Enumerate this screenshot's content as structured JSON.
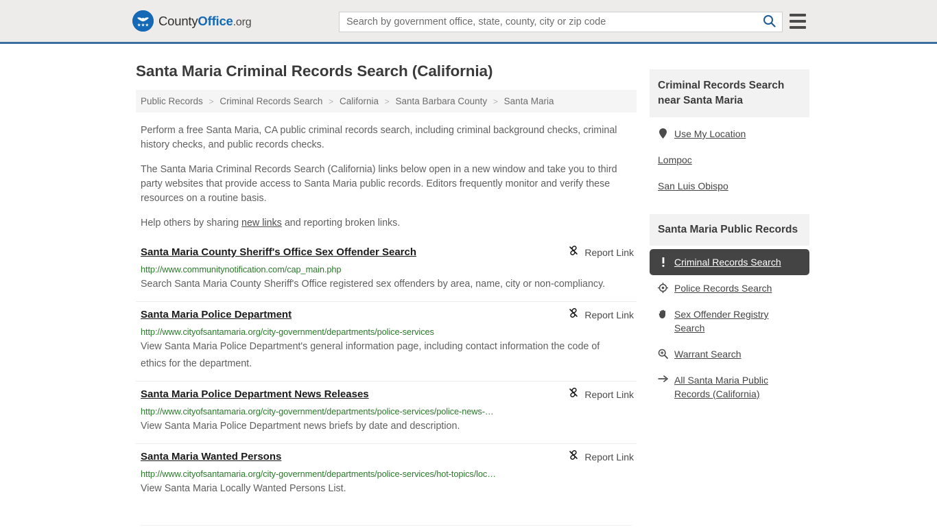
{
  "header": {
    "logo_text_1": "County",
    "logo_text_2": "Office",
    "logo_text_3": ".org",
    "logo_icon": "eagle-seal-icon",
    "search_placeholder": "Search by government office, state, county, city or zip code",
    "search_value": "",
    "search_icon": "search-icon",
    "menu_icon": "hamburger-menu-icon",
    "accent_color": "#3c6e9f",
    "logo_blue": "#1569b5"
  },
  "page": {
    "title": "Santa Maria Criminal Records Search (California)",
    "breadcrumb": [
      "Public Records",
      "Criminal Records Search",
      "California",
      "Santa Barbara County",
      "Santa Maria"
    ],
    "breadcrumb_separator": ">",
    "paragraphs": [
      "Perform a free Santa Maria, CA public criminal records search, including criminal background checks, criminal history checks, and public records checks.",
      "The Santa Maria Criminal Records Search (California) links below open in a new window and take you to third party websites that provide access to Santa Maria public records. Editors frequently monitor and verify these resources on a routine basis."
    ],
    "help_prefix": "Help others by sharing ",
    "help_link": "new links",
    "help_suffix": " and reporting broken links."
  },
  "results": {
    "report_label": "Report Link",
    "report_icon": "broken-link-icon",
    "items": [
      {
        "title": "Santa Maria County Sheriff's Office Sex Offender Search",
        "url": "http://www.communitynotification.com/cap_main.php",
        "description": "Search Santa Maria County Sheriff's Office registered sex offenders by area, name, city or non-compliancy."
      },
      {
        "title": "Santa Maria Police Department",
        "url": "http://www.cityofsantamaria.org/city-government/departments/police-services",
        "description": "View Santa Maria Police Department's general information page, including contact information the code of ethics for the department."
      },
      {
        "title": "Santa Maria Police Department News Releases",
        "url": "http://www.cityofsantamaria.org/city-government/departments/police-services/police-news-…",
        "description": "View Santa Maria Police Department news briefs by date and description."
      },
      {
        "title": "Santa Maria Wanted Persons",
        "url": "http://www.cityofsantamaria.org/city-government/departments/police-services/hot-topics/loc…",
        "description": "View Santa Maria Locally Wanted Persons List."
      }
    ]
  },
  "sidebar": {
    "nearby": {
      "heading": "Criminal Records Search near Santa Maria",
      "items": [
        {
          "label": "Use My Location",
          "icon": "map-pin-icon"
        },
        {
          "label": "Lompoc",
          "icon": "none"
        },
        {
          "label": "San Luis Obispo",
          "icon": "none"
        }
      ]
    },
    "public_records": {
      "heading": "Santa Maria Public Records",
      "active_bg": "#444444",
      "items": [
        {
          "label": "Criminal Records Search",
          "icon": "exclamation-icon",
          "active": true
        },
        {
          "label": "Police Records Search",
          "icon": "police-badge-icon",
          "active": false
        },
        {
          "label": "Sex Offender Registry Search",
          "icon": "hand-icon",
          "active": false
        },
        {
          "label": "Warrant Search",
          "icon": "magnifier-plus-icon",
          "active": false
        },
        {
          "label": "All Santa Maria Public Records (California)",
          "icon": "arrow-right-icon",
          "active": false
        }
      ]
    }
  }
}
